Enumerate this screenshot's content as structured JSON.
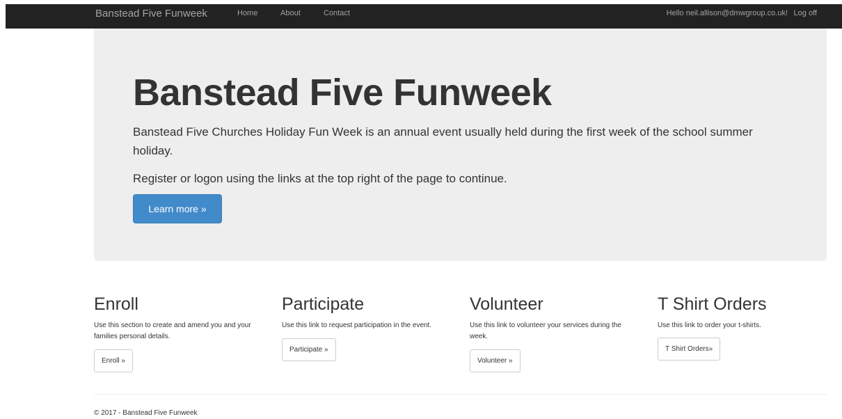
{
  "navbar": {
    "brand": "Banstead Five Funweek",
    "links": [
      "Home",
      "About",
      "Contact"
    ],
    "user_greeting": "Hello neil.allison@dmwgroup.co.uk!",
    "logoff": "Log off"
  },
  "jumbotron": {
    "title": "Banstead Five Funweek",
    "description": "Banstead Five Churches Holiday Fun Week is an annual event usually held during the first week of the school summer holiday.",
    "register_text": "Register or logon using the links at the top right of the page to continue.",
    "learn_more_label": "Learn more »"
  },
  "sections": [
    {
      "title": "Enroll",
      "text": "Use this section to create and amend you and your families personal details.",
      "button_label": "Enroll »"
    },
    {
      "title": "Participate",
      "text": "Use this link to request participation in the event.",
      "button_label": "Participate »"
    },
    {
      "title": "Volunteer",
      "text": "Use this link to volunteer your services during the week.",
      "button_label": "Volunteer »"
    },
    {
      "title": "T Shirt Orders",
      "text": "Use this link to order your t-shirts.",
      "button_label": "T Shirt Orders»"
    }
  ],
  "footer": {
    "text": "© 2017 - Banstead Five Funweek"
  },
  "colors": {
    "navbar_bg": "#222222",
    "jumbotron_bg": "#eeeeee",
    "primary_button": "#428bca"
  }
}
